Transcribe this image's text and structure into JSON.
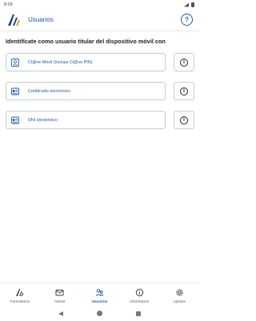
{
  "status_bar": {
    "time": "8:09"
  },
  "app_bar": {
    "title": "Usuarios",
    "help_symbol": "?"
  },
  "heading": "Identifícate como usuario titular del dispositivo móvil con",
  "options": [
    {
      "label": "Cl@ve Móvil (incluye Cl@ve PIN)",
      "icon": "id-card-icon"
    },
    {
      "label": "Certificado electrónico",
      "icon": "certificate-icon"
    },
    {
      "label": "DNI electrónico",
      "icon": "dni-card-icon"
    }
  ],
  "info_symbol": "i",
  "bottom_nav": [
    {
      "label": "Formularios",
      "icon": "aeat-logo-icon",
      "active": false
    },
    {
      "label": "Avisos",
      "icon": "mail-icon",
      "active": false
    },
    {
      "label": "Usuarios",
      "icon": "users-icon",
      "active": true
    },
    {
      "label": "Información",
      "icon": "info-icon",
      "active": false
    },
    {
      "label": "Ajustes",
      "icon": "gear-icon",
      "active": false
    }
  ],
  "colors": {
    "accent": "#1f5aa6",
    "border": "#c4cbd6",
    "text": "#222222"
  }
}
